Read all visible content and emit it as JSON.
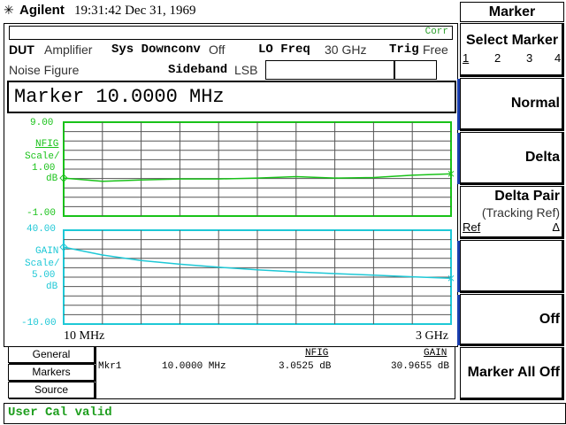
{
  "header": {
    "logo_icon": "agilent-spark-icon",
    "brand": "Agilent",
    "clock": "19:31:42  Dec 31, 1969"
  },
  "corr_label": "Corr",
  "setup": {
    "dut_label": "DUT",
    "dut_value": "Amplifier",
    "sysdown_label": "Sys Downconv",
    "sysdown_value": "Off",
    "lofreq_label": "LO Freq",
    "lofreq_value": "30 GHz",
    "trig_label": "Trig",
    "trig_value": "Free",
    "meas_label": "Noise Figure",
    "sideband_label": "Sideband",
    "sideband_value": "LSB"
  },
  "marker_readout": "Marker 10.0000 MHz",
  "graph1": {
    "top": "9.00",
    "name": "NFIG",
    "scale_label": "Scale/",
    "scale_value": "1.00",
    "unit": "dB",
    "bottom": "-1.00",
    "color": "#19c219"
  },
  "graph2": {
    "top": "40.00",
    "name": "GAIN",
    "scale_label": "Scale/",
    "scale_value": "5.00",
    "unit": "dB",
    "bottom": "-10.00",
    "color": "#1ec8d6"
  },
  "freq_start": "10 MHz",
  "freq_stop": "3 GHz",
  "chart_data": [
    {
      "type": "line",
      "ylim": [
        -1,
        9
      ],
      "x": [
        0,
        1,
        2,
        3,
        4,
        5,
        6,
        7,
        8,
        9,
        10
      ],
      "series": [
        {
          "name": "NFIG",
          "values": [
            3.05,
            2.7,
            2.85,
            2.95,
            2.95,
            3.05,
            3.2,
            3.05,
            3.1,
            3.35,
            3.5
          ]
        }
      ]
    },
    {
      "type": "line",
      "ylim": [
        -10,
        40
      ],
      "x": [
        0,
        1,
        2,
        3,
        4,
        5,
        6,
        7,
        8,
        9,
        10
      ],
      "series": [
        {
          "name": "GAIN",
          "values": [
            30.97,
            26.8,
            23.8,
            21.9,
            20.3,
            18.9,
            17.8,
            16.9,
            16.1,
            15.2,
            14.4
          ]
        }
      ]
    }
  ],
  "tabs": [
    "General",
    "Markers",
    "Source"
  ],
  "readout": {
    "mkr": "Mkr1",
    "freq": "10.0000 MHz",
    "nfig_head": "NFIG",
    "nfig_val": "3.0525 dB",
    "gain_head": "GAIN",
    "gain_val": "30.9655 dB"
  },
  "menu": {
    "title": "Marker",
    "select_marker": "Select Marker",
    "marker_numbers": [
      "1",
      "2",
      "3",
      "4"
    ],
    "normal": "Normal",
    "delta": "Delta",
    "delta_pair": "Delta Pair",
    "tracking_ref": "(Tracking Ref)",
    "ref": "Ref",
    "delta_symbol": "Δ",
    "off": "Off",
    "marker_all_off": "Marker All Off"
  },
  "status": "User Cal valid"
}
